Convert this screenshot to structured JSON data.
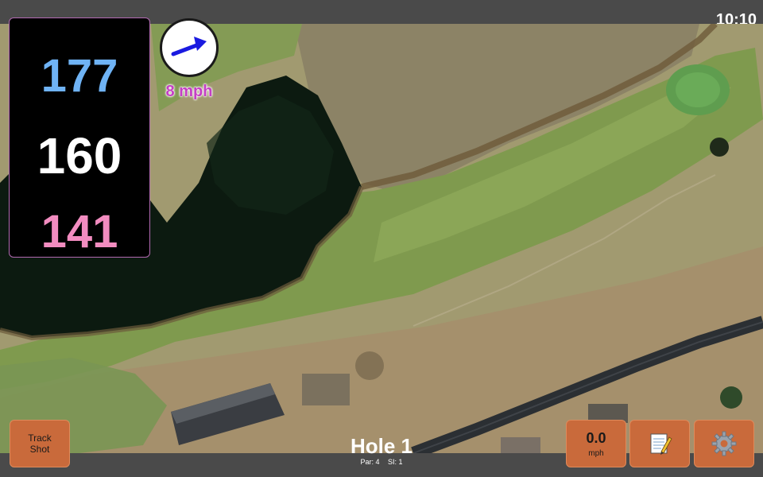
{
  "status_bar": {
    "time": "10:10"
  },
  "yardages": {
    "back": "177",
    "middle": "160",
    "front": "141",
    "colors": {
      "back": "#6fb3f5",
      "middle": "#ffffff",
      "front": "#f28cc0"
    }
  },
  "wind": {
    "speed_label": "8 mph",
    "speed_color": "#c43fc4",
    "direction_icon": "arrow-icon"
  },
  "buttons": {
    "track_shot": "Track\nShot",
    "speed_value": "0.0",
    "speed_unit": "mph",
    "notes_icon": "notepad-icon",
    "settings_icon": "gear-icon"
  },
  "hole": {
    "title": "Hole 1",
    "par_label": "Par: 4",
    "si_label": "SI: 1"
  },
  "colors": {
    "button_bg": "#c96a3b",
    "panel_bg": "#000000",
    "panel_border": "#b26ab2"
  }
}
